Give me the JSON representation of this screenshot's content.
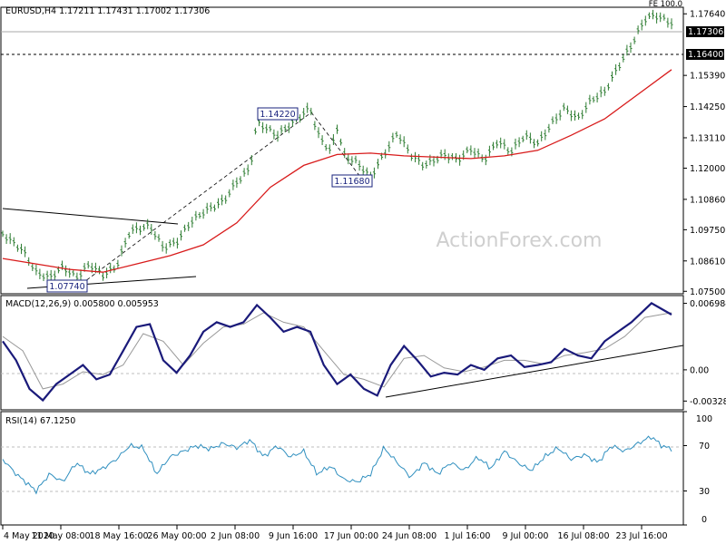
{
  "header": {
    "symbol_info": "EURUSD,H4  1.17211 1.17431 1.17002 1.17306",
    "fe_label": "FE 100.0"
  },
  "watermark": "ActionForex.com",
  "colors": {
    "candle": "#2e7d32",
    "sma": "#d81b1b",
    "macd": "#1a1a7a",
    "signal": "#999999",
    "rsi": "#2f8fbf",
    "trendline": "#000000"
  },
  "chart_data": [
    {
      "type": "candlestick",
      "name": "EURUSD,H4",
      "ohlc_last": {
        "open": 1.17211,
        "high": 1.17431,
        "low": 1.17002,
        "close": 1.17306
      },
      "ylim": [
        1.0741,
        1.1788
      ],
      "price_axis_ticks": [
        "1.17640",
        "1.16400",
        "1.15390",
        "1.14250",
        "1.13110",
        "1.12000",
        "1.10860",
        "1.09750",
        "1.08610",
        "1.07500"
      ],
      "current_price_label": "1.17306",
      "horizontal_level": "1.16400",
      "annotations": [
        "1.14220",
        "1.11680",
        "1.07740"
      ],
      "x_labels": [
        "4 May 2020",
        "11 May 08:00",
        "18 May 16:00",
        "26 May 00:00",
        "2 Jun 08:00",
        "9 Jun 16:00",
        "17 Jun 00:00",
        "24 Jun 08:00",
        "1 Jul 16:00",
        "9 Jul 00:00",
        "16 Jul 08:00",
        "23 Jul 16:00"
      ],
      "price_path": [
        {
          "t": 0.0,
          "v": 1.096
        },
        {
          "t": 0.03,
          "v": 1.09
        },
        {
          "t": 0.05,
          "v": 1.082
        },
        {
          "t": 0.07,
          "v": 1.08
        },
        {
          "t": 0.09,
          "v": 1.084
        },
        {
          "t": 0.11,
          "v": 1.08
        },
        {
          "t": 0.13,
          "v": 1.085
        },
        {
          "t": 0.15,
          "v": 1.081
        },
        {
          "t": 0.17,
          "v": 1.084
        },
        {
          "t": 0.19,
          "v": 1.097
        },
        {
          "t": 0.22,
          "v": 1.099
        },
        {
          "t": 0.24,
          "v": 1.091
        },
        {
          "t": 0.26,
          "v": 1.093
        },
        {
          "t": 0.28,
          "v": 1.1
        },
        {
          "t": 0.3,
          "v": 1.104
        },
        {
          "t": 0.33,
          "v": 1.108
        },
        {
          "t": 0.35,
          "v": 1.115
        },
        {
          "t": 0.37,
          "v": 1.12
        },
        {
          "t": 0.38,
          "v": 1.137
        },
        {
          "t": 0.41,
          "v": 1.132
        },
        {
          "t": 0.44,
          "v": 1.138
        },
        {
          "t": 0.46,
          "v": 1.1422
        },
        {
          "t": 0.47,
          "v": 1.133
        },
        {
          "t": 0.49,
          "v": 1.126
        },
        {
          "t": 0.5,
          "v": 1.135
        },
        {
          "t": 0.51,
          "v": 1.125
        },
        {
          "t": 0.53,
          "v": 1.122
        },
        {
          "t": 0.55,
          "v": 1.1168
        },
        {
          "t": 0.57,
          "v": 1.125
        },
        {
          "t": 0.59,
          "v": 1.133
        },
        {
          "t": 0.61,
          "v": 1.125
        },
        {
          "t": 0.63,
          "v": 1.121
        },
        {
          "t": 0.66,
          "v": 1.125
        },
        {
          "t": 0.68,
          "v": 1.123
        },
        {
          "t": 0.7,
          "v": 1.127
        },
        {
          "t": 0.72,
          "v": 1.123
        },
        {
          "t": 0.74,
          "v": 1.13
        },
        {
          "t": 0.76,
          "v": 1.126
        },
        {
          "t": 0.78,
          "v": 1.132
        },
        {
          "t": 0.8,
          "v": 1.129
        },
        {
          "t": 0.82,
          "v": 1.136
        },
        {
          "t": 0.84,
          "v": 1.142
        },
        {
          "t": 0.86,
          "v": 1.138
        },
        {
          "t": 0.88,
          "v": 1.145
        },
        {
          "t": 0.9,
          "v": 1.148
        },
        {
          "t": 0.92,
          "v": 1.157
        },
        {
          "t": 0.94,
          "v": 1.165
        },
        {
          "t": 0.96,
          "v": 1.1745
        },
        {
          "t": 0.975,
          "v": 1.176
        },
        {
          "t": 1.0,
          "v": 1.1731
        }
      ],
      "moving_average_path": [
        {
          "t": 0.0,
          "v": 1.087
        },
        {
          "t": 0.05,
          "v": 1.085
        },
        {
          "t": 0.1,
          "v": 1.083
        },
        {
          "t": 0.15,
          "v": 1.082
        },
        {
          "t": 0.2,
          "v": 1.085
        },
        {
          "t": 0.25,
          "v": 1.088
        },
        {
          "t": 0.3,
          "v": 1.092
        },
        {
          "t": 0.35,
          "v": 1.1
        },
        {
          "t": 0.4,
          "v": 1.113
        },
        {
          "t": 0.45,
          "v": 1.121
        },
        {
          "t": 0.5,
          "v": 1.125
        },
        {
          "t": 0.55,
          "v": 1.1255
        },
        {
          "t": 0.6,
          "v": 1.1245
        },
        {
          "t": 0.65,
          "v": 1.124
        },
        {
          "t": 0.7,
          "v": 1.1235
        },
        {
          "t": 0.75,
          "v": 1.1245
        },
        {
          "t": 0.8,
          "v": 1.1265
        },
        {
          "t": 0.85,
          "v": 1.132
        },
        {
          "t": 0.9,
          "v": 1.138
        },
        {
          "t": 0.95,
          "v": 1.147
        },
        {
          "t": 1.0,
          "v": 1.156
        }
      ]
    },
    {
      "type": "line",
      "name": "MACD(12,26,9) 0.005800 0.005953",
      "ylim": [
        -0.0042,
        0.0078
      ],
      "axis_ticks": [
        {
          "label": "0.006984",
          "value": 0.006984
        },
        {
          "label": "0.00",
          "value": 0.0
        },
        {
          "label": "-0.00328",
          "value": -0.00328
        }
      ],
      "series": [
        {
          "name": "MACD",
          "path": [
            {
              "t": 0.0,
              "v": 0.003
            },
            {
              "t": 0.02,
              "v": 0.001
            },
            {
              "t": 0.04,
              "v": -0.002
            },
            {
              "t": 0.06,
              "v": -0.0032
            },
            {
              "t": 0.08,
              "v": -0.0015
            },
            {
              "t": 0.1,
              "v": -0.0005
            },
            {
              "t": 0.12,
              "v": 0.0005
            },
            {
              "t": 0.14,
              "v": -0.001
            },
            {
              "t": 0.16,
              "v": -0.0005
            },
            {
              "t": 0.18,
              "v": 0.002
            },
            {
              "t": 0.2,
              "v": 0.0045
            },
            {
              "t": 0.22,
              "v": 0.0048
            },
            {
              "t": 0.24,
              "v": 0.001
            },
            {
              "t": 0.26,
              "v": -0.0003
            },
            {
              "t": 0.28,
              "v": 0.0015
            },
            {
              "t": 0.3,
              "v": 0.004
            },
            {
              "t": 0.32,
              "v": 0.005
            },
            {
              "t": 0.34,
              "v": 0.0045
            },
            {
              "t": 0.36,
              "v": 0.005
            },
            {
              "t": 0.38,
              "v": 0.0068
            },
            {
              "t": 0.4,
              "v": 0.0055
            },
            {
              "t": 0.42,
              "v": 0.004
            },
            {
              "t": 0.44,
              "v": 0.0045
            },
            {
              "t": 0.46,
              "v": 0.004
            },
            {
              "t": 0.48,
              "v": 0.0005
            },
            {
              "t": 0.5,
              "v": -0.0015
            },
            {
              "t": 0.52,
              "v": -0.0005
            },
            {
              "t": 0.54,
              "v": -0.002
            },
            {
              "t": 0.56,
              "v": -0.0027
            },
            {
              "t": 0.58,
              "v": 0.0005
            },
            {
              "t": 0.6,
              "v": 0.0025
            },
            {
              "t": 0.62,
              "v": 0.001
            },
            {
              "t": 0.64,
              "v": -0.0007
            },
            {
              "t": 0.66,
              "v": -0.0003
            },
            {
              "t": 0.68,
              "v": -0.0005
            },
            {
              "t": 0.7,
              "v": 0.0005
            },
            {
              "t": 0.72,
              "v": 0.0
            },
            {
              "t": 0.74,
              "v": 0.0012
            },
            {
              "t": 0.76,
              "v": 0.0015
            },
            {
              "t": 0.78,
              "v": 0.0003
            },
            {
              "t": 0.8,
              "v": 0.0005
            },
            {
              "t": 0.82,
              "v": 0.0008
            },
            {
              "t": 0.84,
              "v": 0.0022
            },
            {
              "t": 0.86,
              "v": 0.0015
            },
            {
              "t": 0.88,
              "v": 0.0012
            },
            {
              "t": 0.9,
              "v": 0.003
            },
            {
              "t": 0.92,
              "v": 0.004
            },
            {
              "t": 0.94,
              "v": 0.005
            },
            {
              "t": 0.97,
              "v": 0.007
            },
            {
              "t": 1.0,
              "v": 0.0058
            }
          ]
        },
        {
          "name": "Signal",
          "path": [
            {
              "t": 0.0,
              "v": 0.0035
            },
            {
              "t": 0.03,
              "v": 0.002
            },
            {
              "t": 0.06,
              "v": -0.002
            },
            {
              "t": 0.09,
              "v": -0.0015
            },
            {
              "t": 0.12,
              "v": -0.0002
            },
            {
              "t": 0.15,
              "v": -0.0005
            },
            {
              "t": 0.18,
              "v": 0.0005
            },
            {
              "t": 0.21,
              "v": 0.0038
            },
            {
              "t": 0.24,
              "v": 0.003
            },
            {
              "t": 0.27,
              "v": 0.0005
            },
            {
              "t": 0.3,
              "v": 0.0028
            },
            {
              "t": 0.33,
              "v": 0.0045
            },
            {
              "t": 0.36,
              "v": 0.0048
            },
            {
              "t": 0.39,
              "v": 0.006
            },
            {
              "t": 0.42,
              "v": 0.005
            },
            {
              "t": 0.45,
              "v": 0.0045
            },
            {
              "t": 0.48,
              "v": 0.002
            },
            {
              "t": 0.51,
              "v": -0.0005
            },
            {
              "t": 0.54,
              "v": -0.001
            },
            {
              "t": 0.57,
              "v": -0.0018
            },
            {
              "t": 0.6,
              "v": 0.0012
            },
            {
              "t": 0.63,
              "v": 0.0015
            },
            {
              "t": 0.66,
              "v": 0.0002
            },
            {
              "t": 0.69,
              "v": -0.0002
            },
            {
              "t": 0.72,
              "v": 0.0003
            },
            {
              "t": 0.75,
              "v": 0.001
            },
            {
              "t": 0.78,
              "v": 0.001
            },
            {
              "t": 0.81,
              "v": 0.0006
            },
            {
              "t": 0.84,
              "v": 0.0015
            },
            {
              "t": 0.87,
              "v": 0.0018
            },
            {
              "t": 0.9,
              "v": 0.0022
            },
            {
              "t": 0.93,
              "v": 0.0035
            },
            {
              "t": 0.96,
              "v": 0.0055
            },
            {
              "t": 1.0,
              "v": 0.006
            }
          ]
        }
      ]
    },
    {
      "type": "line",
      "name": "RSI(14) 67.1250",
      "ylim": [
        0,
        100
      ],
      "axis_ticks": [
        {
          "label": "100",
          "value": 100
        },
        {
          "label": "70",
          "value": 70
        },
        {
          "label": "30",
          "value": 30
        },
        {
          "label": "0",
          "value": 0
        }
      ],
      "reference_levels": [
        70,
        30
      ],
      "series": [
        {
          "name": "RSI",
          "path": [
            {
              "t": 0.0,
              "v": 58
            },
            {
              "t": 0.02,
              "v": 45
            },
            {
              "t": 0.04,
              "v": 35
            },
            {
              "t": 0.05,
              "v": 30
            },
            {
              "t": 0.07,
              "v": 45
            },
            {
              "t": 0.09,
              "v": 38
            },
            {
              "t": 0.11,
              "v": 55
            },
            {
              "t": 0.13,
              "v": 45
            },
            {
              "t": 0.15,
              "v": 50
            },
            {
              "t": 0.17,
              "v": 58
            },
            {
              "t": 0.19,
              "v": 70
            },
            {
              "t": 0.21,
              "v": 68
            },
            {
              "t": 0.23,
              "v": 45
            },
            {
              "t": 0.25,
              "v": 60
            },
            {
              "t": 0.27,
              "v": 65
            },
            {
              "t": 0.29,
              "v": 70
            },
            {
              "t": 0.31,
              "v": 67
            },
            {
              "t": 0.33,
              "v": 72
            },
            {
              "t": 0.35,
              "v": 68
            },
            {
              "t": 0.37,
              "v": 75
            },
            {
              "t": 0.39,
              "v": 60
            },
            {
              "t": 0.41,
              "v": 70
            },
            {
              "t": 0.43,
              "v": 60
            },
            {
              "t": 0.45,
              "v": 65
            },
            {
              "t": 0.47,
              "v": 45
            },
            {
              "t": 0.49,
              "v": 52
            },
            {
              "t": 0.51,
              "v": 40
            },
            {
              "t": 0.53,
              "v": 38
            },
            {
              "t": 0.55,
              "v": 45
            },
            {
              "t": 0.57,
              "v": 68
            },
            {
              "t": 0.59,
              "v": 55
            },
            {
              "t": 0.61,
              "v": 42
            },
            {
              "t": 0.63,
              "v": 55
            },
            {
              "t": 0.65,
              "v": 45
            },
            {
              "t": 0.67,
              "v": 55
            },
            {
              "t": 0.69,
              "v": 48
            },
            {
              "t": 0.71,
              "v": 60
            },
            {
              "t": 0.73,
              "v": 50
            },
            {
              "t": 0.75,
              "v": 65
            },
            {
              "t": 0.77,
              "v": 55
            },
            {
              "t": 0.79,
              "v": 48
            },
            {
              "t": 0.81,
              "v": 60
            },
            {
              "t": 0.83,
              "v": 68
            },
            {
              "t": 0.85,
              "v": 58
            },
            {
              "t": 0.87,
              "v": 62
            },
            {
              "t": 0.89,
              "v": 55
            },
            {
              "t": 0.91,
              "v": 70
            },
            {
              "t": 0.93,
              "v": 65
            },
            {
              "t": 0.95,
              "v": 72
            },
            {
              "t": 0.97,
              "v": 78
            },
            {
              "t": 0.985,
              "v": 70
            },
            {
              "t": 1.0,
              "v": 67
            }
          ]
        }
      ]
    }
  ]
}
